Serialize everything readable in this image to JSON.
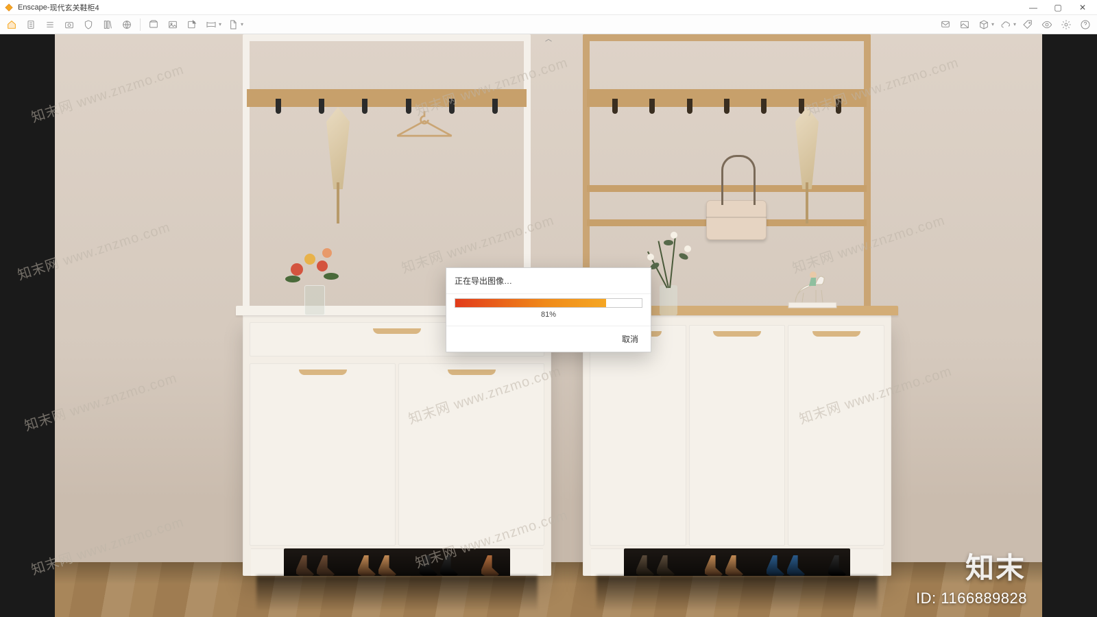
{
  "window": {
    "app_name": "Enscape",
    "doc_name": "现代玄关鞋柜4",
    "title_separator": " - "
  },
  "toolbar_left": [
    {
      "id": "home-icon"
    },
    {
      "id": "page-icon"
    },
    {
      "id": "list-icon"
    },
    {
      "id": "camera-preview-icon"
    },
    {
      "id": "shield-icon"
    },
    {
      "id": "library-icon"
    },
    {
      "id": "globe-icon"
    },
    {
      "sep": true
    },
    {
      "id": "capture-icon"
    },
    {
      "id": "image-icon"
    },
    {
      "id": "export-image-icon"
    },
    {
      "id": "panorama-icon",
      "chev": true
    },
    {
      "id": "export-file-icon",
      "chev": true
    }
  ],
  "toolbar_right": [
    {
      "id": "feedback-icon"
    },
    {
      "id": "gallery-icon"
    },
    {
      "id": "cube-icon",
      "chev": true
    },
    {
      "id": "cloud-icon",
      "chev": true
    },
    {
      "id": "tag-icon"
    },
    {
      "id": "eye-icon"
    },
    {
      "id": "settings-gear-icon"
    },
    {
      "id": "help-icon"
    }
  ],
  "modal": {
    "title": "正在导出图像…",
    "percent_value": 81,
    "percent_label": "81%",
    "cancel_label": "取消"
  },
  "watermark": {
    "text": "知末网 www.znzmo.com",
    "brand": "知末",
    "id_label": "ID: 1166889828"
  }
}
